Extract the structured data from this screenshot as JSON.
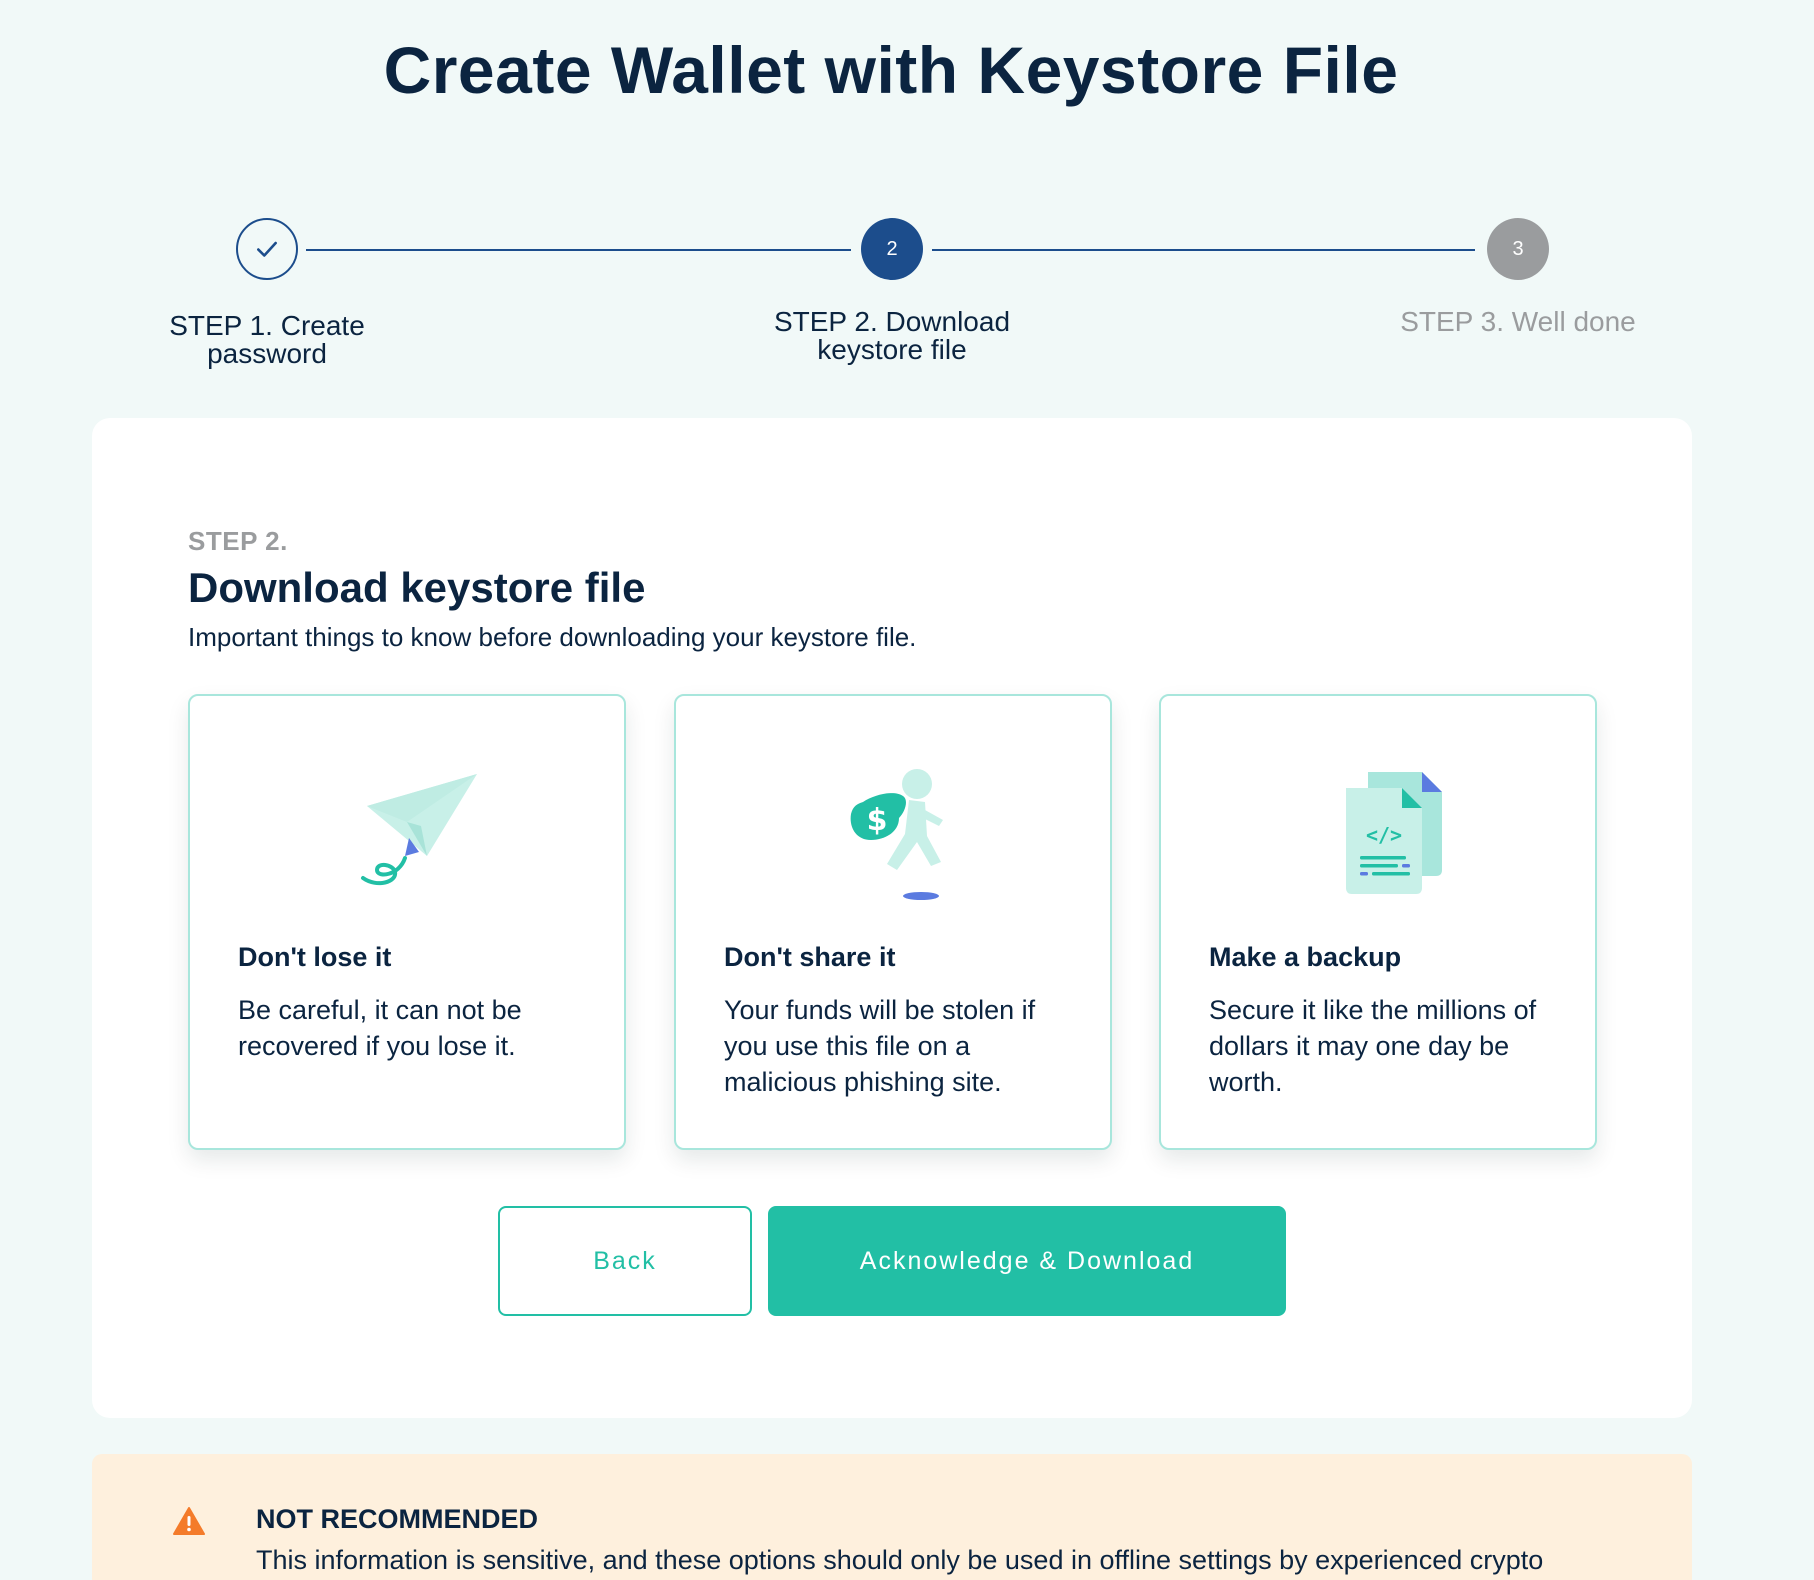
{
  "page": {
    "title": "Create Wallet with Keystore File"
  },
  "stepper": {
    "steps": [
      {
        "number": "1",
        "label_line1": "STEP 1. Create",
        "label_line2": "password",
        "state": "completed",
        "icon": "check-icon"
      },
      {
        "number": "2",
        "label_line1": "STEP 2. Download",
        "label_line2": "keystore file",
        "state": "active"
      },
      {
        "number": "3",
        "label_line1": "STEP 3. Well done",
        "label_line2": "",
        "state": "upcoming"
      }
    ],
    "colors": {
      "active": "#1c4d8c",
      "upcoming": "#9a9c9e"
    }
  },
  "main": {
    "kicker": "STEP 2.",
    "title": "Download keystore file",
    "subtitle": "Important things to know before downloading your keystore file.",
    "cards": [
      {
        "icon": "paper-plane-icon",
        "title": "Don't lose it",
        "text": "Be careful, it can not be recovered if you lose it."
      },
      {
        "icon": "thief-with-money-bag-icon",
        "title": "Don't share it",
        "text": "Your funds will be stolen if you use this file on a malicious phishing site."
      },
      {
        "icon": "code-files-icon",
        "title": "Make a backup",
        "text": "Secure it like the millions of dollars it may one day be worth."
      }
    ],
    "buttons": {
      "back_label": "Back",
      "primary_label": "Acknowledge & Download"
    }
  },
  "warning": {
    "icon": "warning-triangle-icon",
    "title": "NOT RECOMMENDED",
    "text": "This information is sensitive, and these options should only be used in offline settings by experienced crypto"
  },
  "colors": {
    "accent": "#22bfa5",
    "navy": "#0b2440",
    "background": "#f1f9f8",
    "warning_bg": "#fef0dd",
    "warning_icon": "#f47b2a"
  }
}
